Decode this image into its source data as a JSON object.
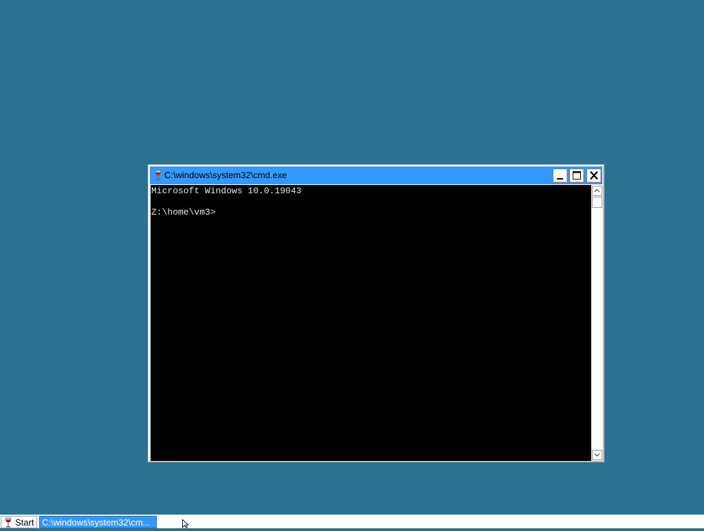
{
  "desktop": {
    "background_color": "#2a7193"
  },
  "window": {
    "title": "C:\\windows\\system32\\cmd.exe",
    "icon": "wine-glass-icon",
    "title_bar_color": "#3399ff",
    "buttons": {
      "minimize": "minimize-icon",
      "maximize": "maximize-icon",
      "close": "close-icon"
    }
  },
  "console": {
    "lines": [
      "Microsoft Windows 10.0.19043",
      "",
      "Z:\\home\\vm3>"
    ],
    "background_color": "#000000",
    "text_color": "#e6e6e6"
  },
  "taskbar": {
    "start_label": "Start",
    "start_icon": "wine-glass-icon",
    "task_label": "C:\\windows\\system32\\cm...",
    "task_color": "#3399ff"
  }
}
